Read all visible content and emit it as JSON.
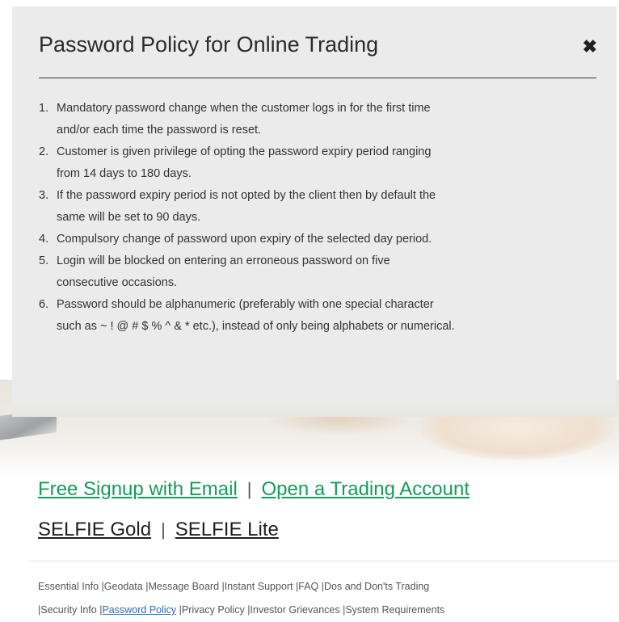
{
  "modal": {
    "title": "Password Policy for Online Trading",
    "close_glyph": "✖",
    "items": [
      {
        "num": "1.",
        "lines": [
          "Mandatory password change when the customer logs in for the first time",
          "and/or each time the password is reset."
        ]
      },
      {
        "num": "2.",
        "lines": [
          "Customer is given privilege of opting the password expiry period ranging",
          "from 14 days to 180 days."
        ]
      },
      {
        "num": "3.",
        "lines": [
          "If the password expiry period is not opted by the client then by default the",
          "same will be set to 90 days."
        ]
      },
      {
        "num": "4.",
        "lines": [
          "Compulsory change of password upon expiry of the selected day period."
        ]
      },
      {
        "num": "5.",
        "lines": [
          "Login will be blocked on entering an erroneous password on five",
          "consecutive occasions."
        ]
      },
      {
        "num": "6.",
        "lines": [
          "Password should be alphanumeric (preferably with one special character",
          "such as ~ ! @ # $ % ^ & * etc.), instead of only being alphabets or numerical."
        ]
      }
    ]
  },
  "signup": {
    "free_signup": "Free Signup with Email",
    "sep": "|",
    "open_account": "Open a Trading Account",
    "selfie_gold": "SELFIE Gold",
    "selfie_lite": "SELFIE Lite"
  },
  "footer": {
    "row1": [
      "Essential Info",
      "|Geodata",
      "|Message Board",
      "|Instant Support",
      "|FAQ",
      "|Dos and Don'ts Trading"
    ],
    "row2_prefix_1": "|Security Info",
    "row2_sep": "|",
    "password_policy": "Password Policy",
    "row2_rest": [
      "|Privacy Policy",
      "|Investor Grievances",
      "|System Requirements"
    ]
  },
  "colors": {
    "accent_green": "#159c5b",
    "active_link_blue": "#2a6ab8",
    "modal_bg": "#ebebeb"
  }
}
